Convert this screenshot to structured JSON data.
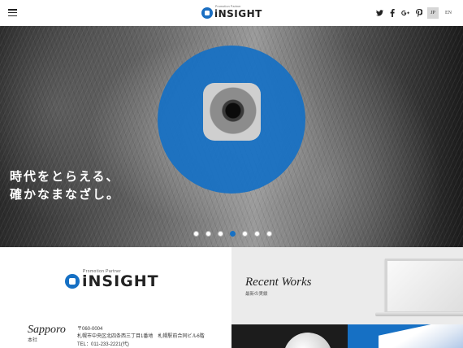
{
  "header": {
    "logo_text": "iNSIGHT",
    "logo_tagline": "Promotion Partner",
    "social": [
      {
        "icon": "twitter-icon",
        "glyph": "t"
      },
      {
        "icon": "facebook-icon",
        "glyph": "f"
      },
      {
        "icon": "google-plus-icon",
        "glyph": "g+"
      },
      {
        "icon": "pinterest-icon",
        "glyph": "p"
      }
    ],
    "languages": [
      "JP",
      "EN"
    ],
    "active_language": "JP"
  },
  "hero": {
    "tagline_line1": "時代をとらえる、",
    "tagline_line2": "確かなまなざし。",
    "slide_count": 7,
    "active_slide": 4
  },
  "company": {
    "logo_text": "iNSIGHT",
    "logo_tagline": "Promotion Partner",
    "office_name": "Sapporo",
    "office_sub": "本社",
    "postal": "〒060-0004",
    "address": "札幌市中央区北四条西三丁目1番地　札幌駅前合同ビル6階",
    "tel": "TEL：011-233-2221(代)"
  },
  "works": {
    "title": "Recent Works",
    "subtitle": "最新の実績"
  },
  "colors": {
    "brand_blue": "#1670c4",
    "works_bg": "#ebebeb"
  }
}
